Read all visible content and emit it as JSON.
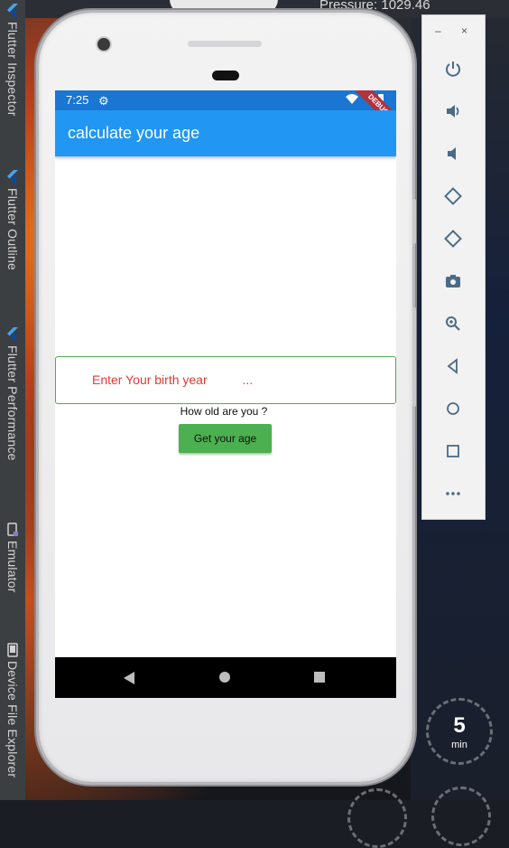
{
  "desktop": {
    "pressure": "Pressure: 1029.46",
    "timer_value": "5",
    "timer_unit": "min"
  },
  "tool_windows": [
    {
      "label": "Flutter Inspector",
      "icon": "flutter-icon"
    },
    {
      "label": "Flutter Outline",
      "icon": "flutter-icon"
    },
    {
      "label": "Flutter Performance",
      "icon": "flutter-icon"
    },
    {
      "label": "Emulator",
      "icon": "emulator-icon"
    },
    {
      "label": "Device File Explorer",
      "icon": "device-icon"
    }
  ],
  "status_bar": {
    "time": "7:25"
  },
  "debug_banner": "DEBUG",
  "app": {
    "title": "calculate your age",
    "input_hint": "Enter Your birth year          ...",
    "question": "How old are you ?",
    "button_label": "Get your age"
  },
  "colors": {
    "status_bar": "#1976d2",
    "app_bar": "#2196f3",
    "input_border": "#4caf50",
    "hint": "#e53935",
    "button": "#4caf50",
    "debug": "#b2323e"
  },
  "emulator_panel": {
    "minimize": "–",
    "close": "×",
    "controls": [
      "power-icon",
      "volume-up-icon",
      "volume-down-icon",
      "rotate-left-icon",
      "rotate-right-icon",
      "camera-icon",
      "zoom-icon",
      "back-icon",
      "home-icon",
      "overview-icon",
      "more-icon"
    ]
  }
}
